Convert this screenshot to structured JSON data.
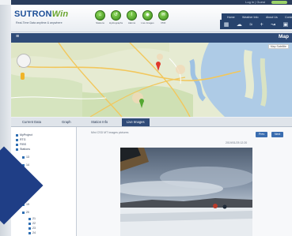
{
  "topstrip": {
    "link_text": "Log in | Guest"
  },
  "header": {
    "logo_main": "SUTRON",
    "logo_win": "Win",
    "logo_sub": "Real-Time Data anytime & anywhere",
    "quick_actions": [
      {
        "label": "Stations",
        "glyph": "⌂"
      },
      {
        "label": "Hydrographs",
        "glyph": "↺"
      },
      {
        "label": "Alarms",
        "glyph": "!"
      },
      {
        "label": "Live Images",
        "glyph": "◉"
      },
      {
        "label": "PDF",
        "glyph": "✉"
      }
    ],
    "nav": [
      "Home",
      "Weather Info",
      "About Us",
      "Contact Us"
    ],
    "nav_icons": [
      "map-icon",
      "cloud-icon",
      "wave-icon",
      "plus-icon",
      "wind-icon",
      "camera-icon"
    ]
  },
  "mapbar": {
    "menu_glyph": "≡",
    "title": "Map"
  },
  "map": {
    "control_label": "Map Satellite"
  },
  "tabs": [
    "Current Data",
    "Graph",
    "Station Info",
    "Live Images"
  ],
  "active_tab": "Live Images",
  "tree": {
    "rows": [
      "MyProject",
      "RTG",
      "FIBS",
      "Stations",
      "13",
      "14",
      "15",
      "16",
      "17",
      "18",
      "19",
      "20",
      "21",
      "22",
      "23",
      "24",
      "25"
    ]
  },
  "content": {
    "caption": "Mini CSD MT images pictures",
    "timestamp": "2019/01/25 12:20",
    "prev_label": "Prev",
    "next_label": "Next"
  },
  "colors": {
    "header_blue": "#27436d",
    "accent_green": "#4cae2a",
    "tab_active": "#2f4b78",
    "deco_blue": "#1f3e86"
  }
}
